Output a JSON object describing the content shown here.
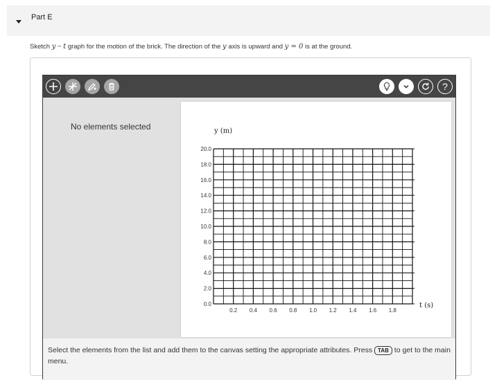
{
  "part": {
    "title": "Part E"
  },
  "instruction": {
    "before": "Sketch ",
    "y_sym": "y",
    "dash": " − ",
    "t_sym": "t",
    "middle": " graph for the motion of the brick. The direction of the ",
    "y_sym2": "y",
    "middle2": " axis is upward and ",
    "eq": "y = 0",
    "end": " is at the ground."
  },
  "toolbar": {
    "left_icons": [
      "plus-icon",
      "no-entry-icon",
      "edit-icon",
      "trash-icon"
    ],
    "right_icons": [
      "hint-bulb-icon",
      "chevron-down-icon",
      "reset-icon",
      "help-icon"
    ],
    "accent": "#ffffff",
    "background": "#454545"
  },
  "side_panel": {
    "empty_text": "No elements selected"
  },
  "bottom": {
    "text_before": "Select the elements from the list and add them to the canvas setting the appropriate attributes. Press ",
    "key": "TAB",
    "text_after": " to get to the main menu."
  },
  "chart_data": {
    "type": "line",
    "xlabel": "t (s)",
    "ylabel": "y (m)",
    "xlim": [
      0,
      2.0
    ],
    "ylim": [
      0,
      20.0
    ],
    "x_ticks": [
      "0.2",
      "0.4",
      "0.6",
      "0.8",
      "1.0",
      "1.2",
      "1.4",
      "1.6",
      "1.8"
    ],
    "y_ticks": [
      "0.0",
      "2.0",
      "4.0",
      "6.0",
      "8.0",
      "10.0",
      "12.0",
      "14.0",
      "16.0",
      "18.0",
      "20.0"
    ],
    "grid": true,
    "series": []
  }
}
